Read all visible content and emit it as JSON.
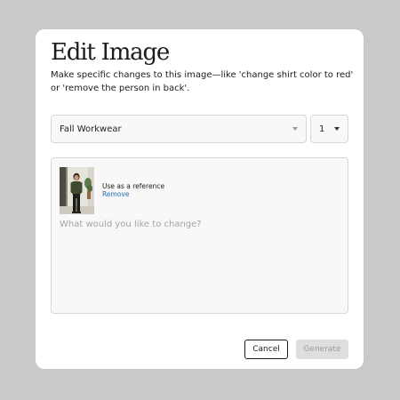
{
  "dialog": {
    "title": "Edit Image",
    "description": "Make specific changes to this image—like 'change shirt color to red' or 'remove the person in back'."
  },
  "collection_select": {
    "value": "Fall Workwear"
  },
  "count_select": {
    "value": "1"
  },
  "reference": {
    "caption": "Use as a reference",
    "remove_label": "Remove"
  },
  "prompt": {
    "value": "",
    "placeholder": "What would you like to change?"
  },
  "actions": {
    "cancel_label": "Cancel",
    "generate_label": "Generate",
    "generate_disabled": true
  }
}
